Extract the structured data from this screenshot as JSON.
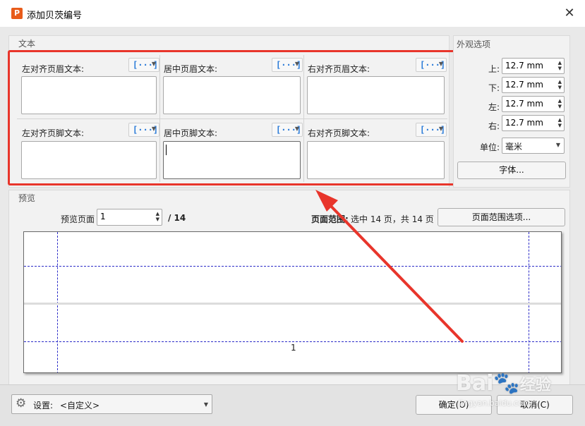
{
  "window": {
    "title": "添加贝茨编号",
    "app_icon_letter": "P"
  },
  "text_group": {
    "title": "文本",
    "cells": [
      {
        "label": "左对齐页眉文本:"
      },
      {
        "label": "居中页眉文本:"
      },
      {
        "label": "右对齐页眉文本:"
      },
      {
        "label": "左对齐页脚文本:"
      },
      {
        "label": "居中页脚文本:"
      },
      {
        "label": "右对齐页脚文本:"
      }
    ],
    "macro_icon": "[···]"
  },
  "appearance_group": {
    "title": "外观选项",
    "margins": [
      {
        "label": "上:",
        "value": "12.7 mm"
      },
      {
        "label": "下:",
        "value": "12.7 mm"
      },
      {
        "label": "左:",
        "value": "12.7 mm"
      },
      {
        "label": "右:",
        "value": "12.7 mm"
      }
    ],
    "unit_label": "单位:",
    "unit_value": "毫米",
    "font_button": "字体..."
  },
  "preview_group": {
    "title": "预览",
    "page_label": "预览页面",
    "page_value": "1",
    "page_total": "/ 14",
    "range_label": "页面范围:",
    "range_info": "选中 14 页，共 14 页",
    "range_button": "页面范围选项...",
    "page_number": "1"
  },
  "bottom": {
    "settings_label": "设置:",
    "settings_value": "<自定义>",
    "ok_button": "确定(O)",
    "cancel_button": "取消(C)"
  },
  "watermark": {
    "brand": "Bai",
    "brand_cn": "经验",
    "url": "jingyan.baidu.com"
  },
  "colors": {
    "highlight": "#e8352b",
    "guide_lines": "#2c2cc8",
    "app_icon": "#e85b1a"
  }
}
